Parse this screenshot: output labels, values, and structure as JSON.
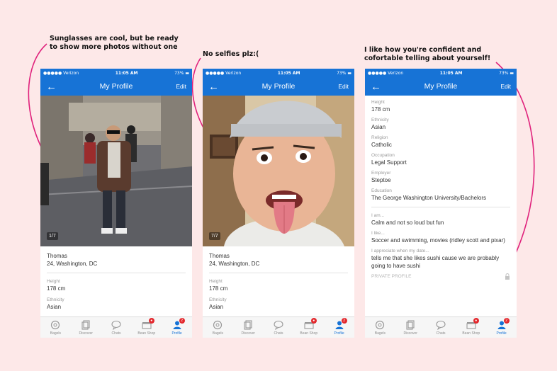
{
  "annotations": {
    "left": "Sunglasses are cool, but be ready to show more photos without one",
    "middle": "No selfies plz:(",
    "right": "I like how you're confident and cofortable telling about yourself!"
  },
  "colors": {
    "accent": "#1773d6",
    "annotation_line": "#e0227c",
    "background": "#fde8e8",
    "badge": "#e3282d"
  },
  "status_bar": {
    "carrier": "●●●●● Verizon",
    "time": "11:05 AM",
    "battery": "73%"
  },
  "nav": {
    "title": "My Profile",
    "edit": "Edit",
    "back_icon": "arrow-left-icon"
  },
  "tabs": [
    {
      "label": "Bagels",
      "icon": "bagel-icon"
    },
    {
      "label": "Discover",
      "icon": "discover-icon"
    },
    {
      "label": "Chats",
      "icon": "chat-icon"
    },
    {
      "label": "Bean Shop",
      "icon": "shop-icon",
      "badge": "●"
    },
    {
      "label": "Profile",
      "icon": "profile-icon",
      "badge": "2",
      "active": true
    }
  ],
  "phone1": {
    "photo_counter": "1/7",
    "name": "Thomas",
    "subtitle": "24, Washington, DC",
    "fields": [
      {
        "label": "Height",
        "value": "178 cm"
      },
      {
        "label": "Ethnicity",
        "value": "Asian"
      }
    ]
  },
  "phone2": {
    "photo_counter": "7/7",
    "name": "Thomas",
    "subtitle": "24, Washington, DC",
    "fields": [
      {
        "label": "Height",
        "value": "178 cm"
      },
      {
        "label": "Ethnicity",
        "value": "Asian"
      }
    ]
  },
  "phone3": {
    "fields": [
      {
        "label": "Height",
        "value": "178 cm"
      },
      {
        "label": "Ethnicity",
        "value": "Asian"
      },
      {
        "label": "Religion",
        "value": "Catholic"
      },
      {
        "label": "Occupation",
        "value": "Legal Support"
      },
      {
        "label": "Employer",
        "value": "Steptoe"
      },
      {
        "label": "Education",
        "value": "The George Washington University/Bachelors"
      }
    ],
    "prompts": [
      {
        "label": "I am...",
        "value": "Calm and not so loud but fun"
      },
      {
        "label": "I like...",
        "value": "Soccer and swimming, movies (ridley scott and pixar)"
      },
      {
        "label": "I appreciate when my date...",
        "value": "tells me that she likes sushi cause we are probably going to have sushi"
      }
    ],
    "private_profile": "PRIVATE PROFILE",
    "lock_icon": "lock-icon"
  }
}
